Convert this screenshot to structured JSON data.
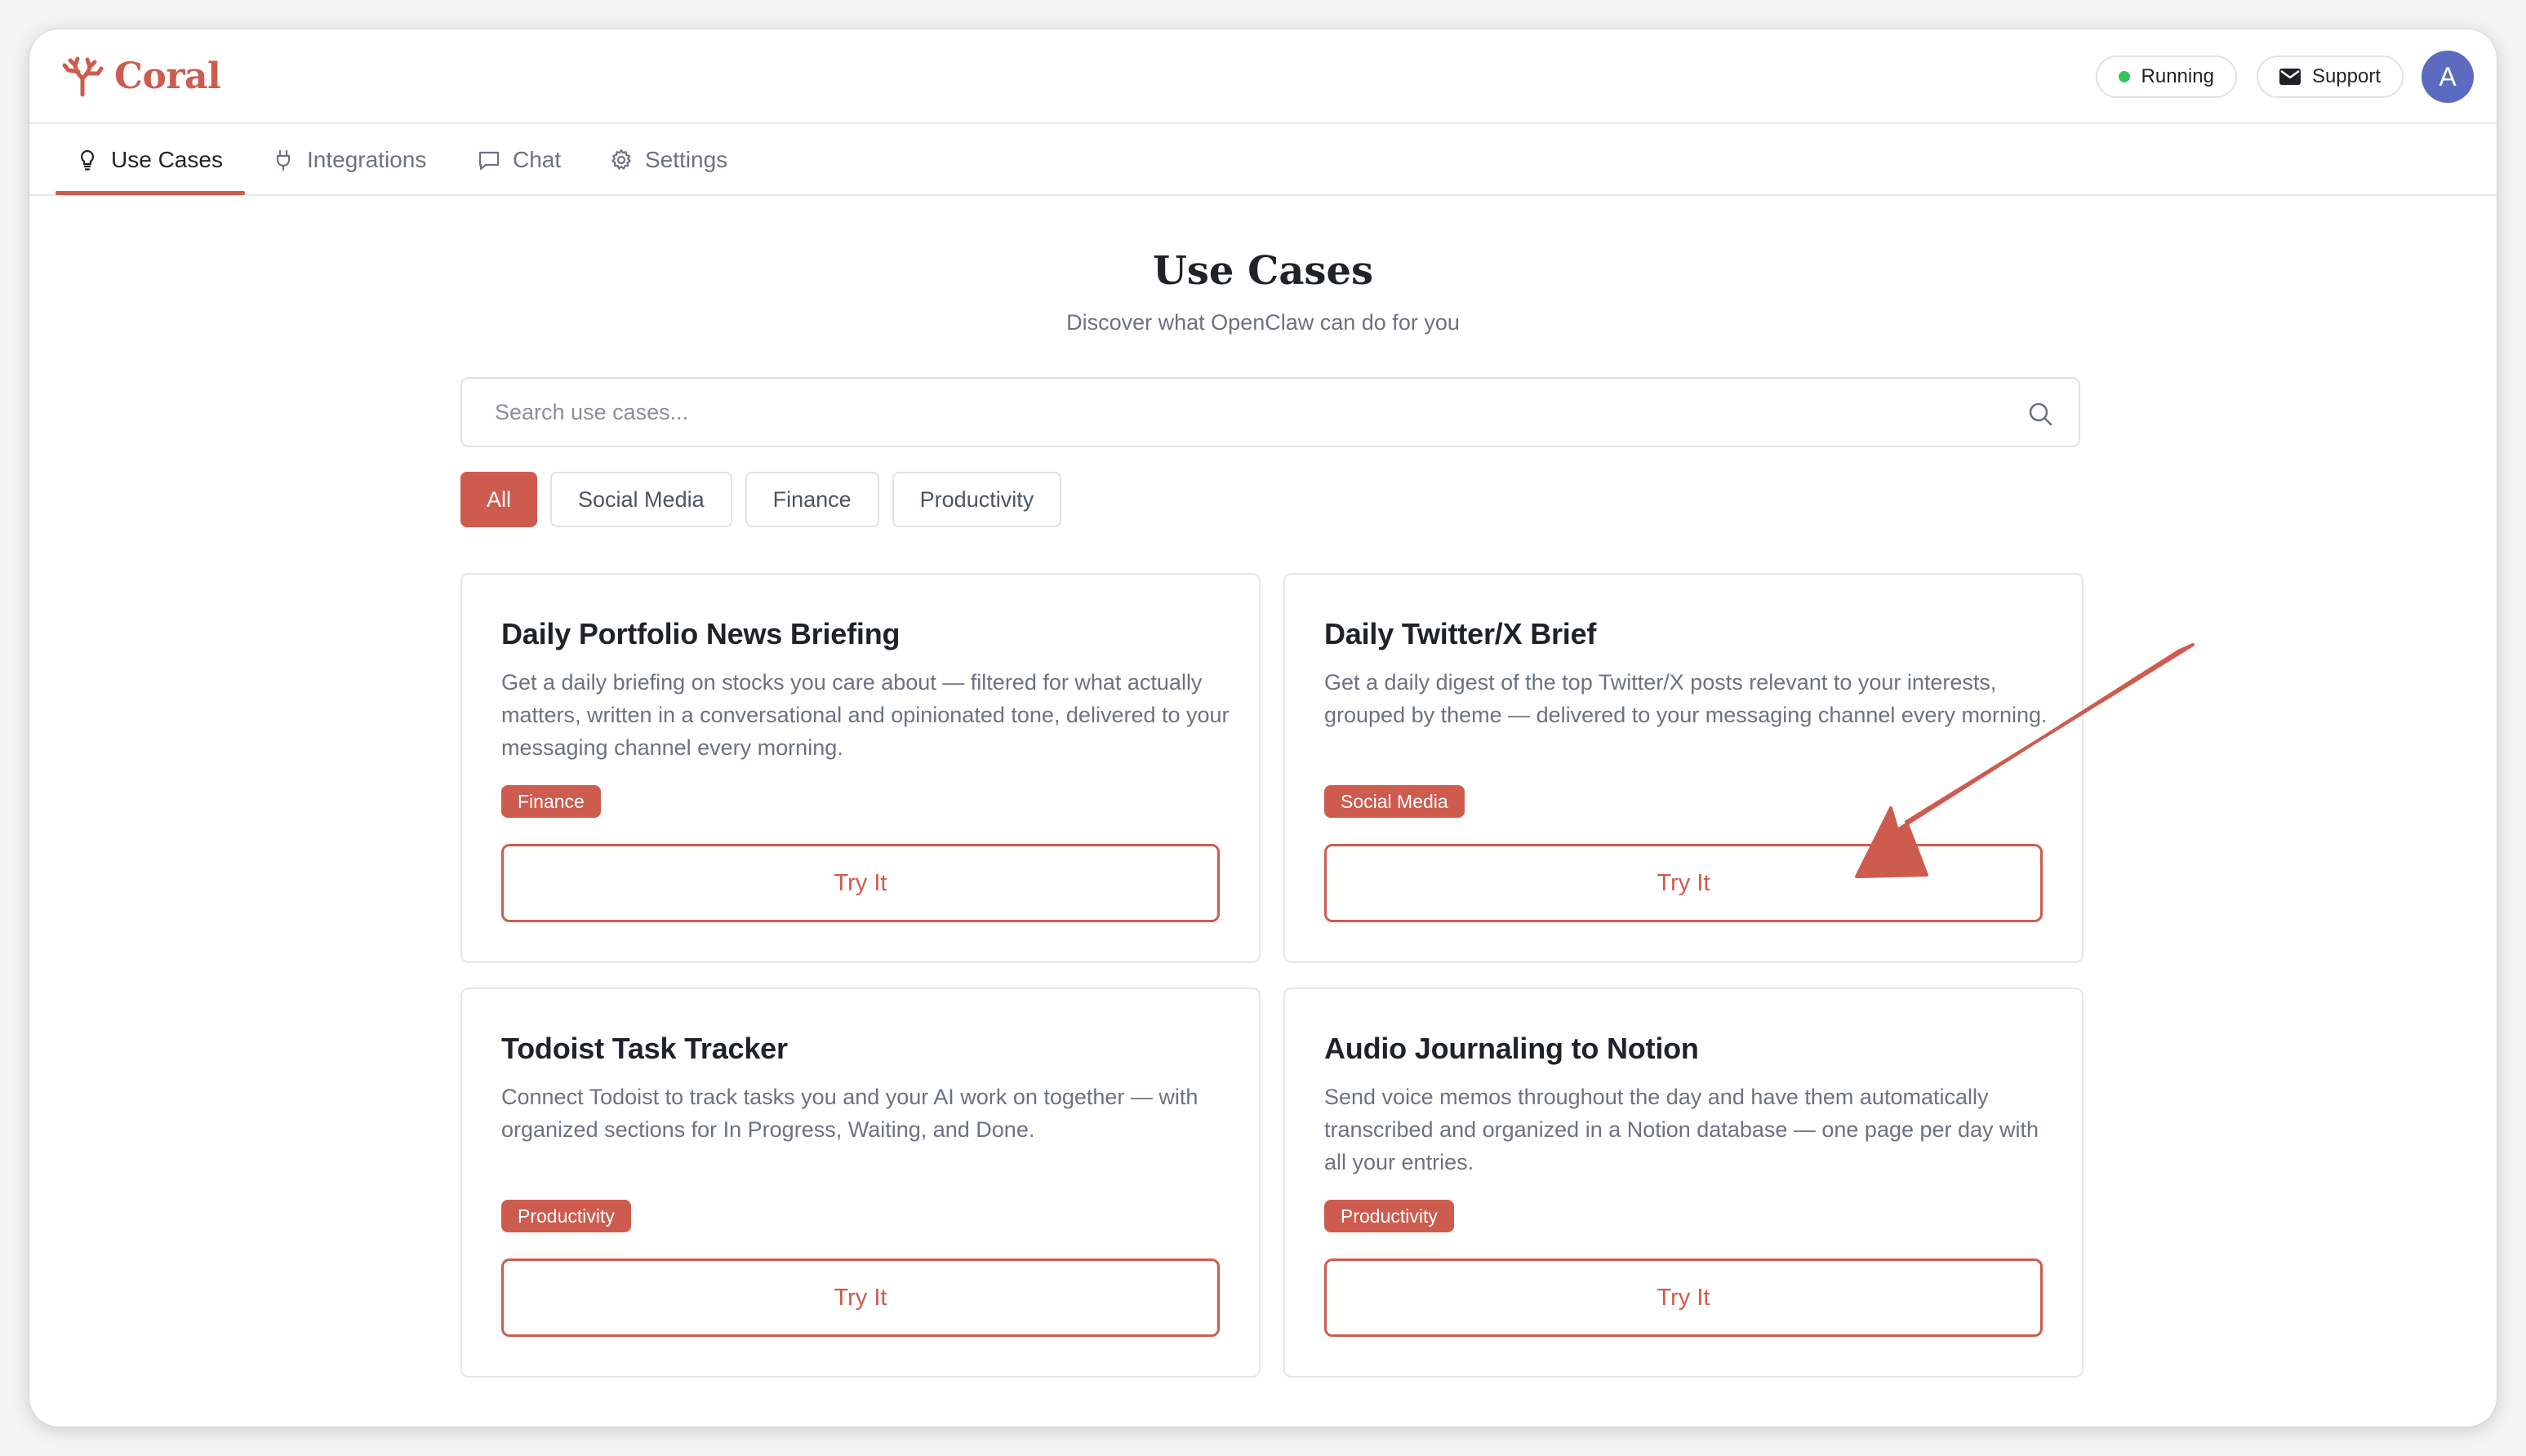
{
  "app": {
    "name": "Coral",
    "logo_icon": "coral-icon",
    "brand_color": "#cd5c4f"
  },
  "header": {
    "status_label": "Running",
    "status_color": "#34c759",
    "support_label": "Support",
    "avatar_initial": "A"
  },
  "tabs": [
    {
      "label": "Use Cases",
      "icon": "lightbulb-icon",
      "active": true
    },
    {
      "label": "Integrations",
      "icon": "plug-icon",
      "active": false
    },
    {
      "label": "Chat",
      "icon": "chat-bubble-icon",
      "active": false
    },
    {
      "label": "Settings",
      "icon": "gear-icon",
      "active": false
    }
  ],
  "main": {
    "title": "Use Cases",
    "subtitle": "Discover what OpenClaw can do for you",
    "search_placeholder": "Search use cases...",
    "search_value": "",
    "filters": [
      {
        "label": "All",
        "active": true
      },
      {
        "label": "Social Media",
        "active": false
      },
      {
        "label": "Finance",
        "active": false
      },
      {
        "label": "Productivity",
        "active": false
      }
    ],
    "cards": [
      {
        "title": "Daily Portfolio News Briefing",
        "description": "Get a daily briefing on stocks you care about — filtered for what actually matters, written in a conversational and opinionated tone, delivered to your messaging channel every morning.",
        "tag": "Finance",
        "button": "Try It"
      },
      {
        "title": "Daily Twitter/X Brief",
        "description": "Get a daily digest of the top Twitter/X posts relevant to your interests, grouped by theme — delivered to your messaging channel every morning.",
        "tag": "Social Media",
        "button": "Try It"
      },
      {
        "title": "Todoist Task Tracker",
        "description": "Connect Todoist to track tasks you and your AI work on together — with organized sections for In Progress, Waiting, and Done.",
        "tag": "Productivity",
        "button": "Try It"
      },
      {
        "title": "Audio Journaling to Notion",
        "description": "Send voice memos throughout the day and have them automatically transcribed and organized in a Notion database — one page per day with all your entries.",
        "tag": "Productivity",
        "button": "Try It"
      }
    ]
  },
  "annotation": {
    "type": "arrow",
    "color": "#cd5c4f",
    "points_to": "Daily Twitter/X Brief Try It button"
  }
}
